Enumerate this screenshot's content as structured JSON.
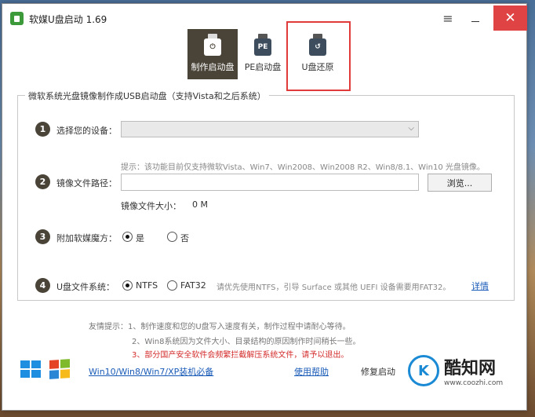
{
  "window": {
    "title": "软媒U盘启动 1.69",
    "menu_icon": "hamburger-icon",
    "min_icon": "minimize-icon",
    "close_glyph": "✕"
  },
  "tabs": [
    {
      "label": "制作启动盘",
      "icon": "power",
      "active": true
    },
    {
      "label": "PE启动盘",
      "icon": "PE",
      "active": false
    },
    {
      "label": "U盘还原",
      "icon": "restore",
      "active": false
    }
  ],
  "group": {
    "title": "微软系统光盘镜像制作成USB启动盘（支持Vista和之后系统）"
  },
  "steps": {
    "s1": {
      "num": "1",
      "label": "选择您的设备："
    },
    "s2": {
      "num": "2",
      "label": "镜像文件路径：",
      "hint": "提示：该功能目前仅支持微软Vista、Win7、Win2008、Win2008 R2、Win8/8.1、Win10 光盘镜像。",
      "browse": "浏览...",
      "size_label": "镜像文件大小：",
      "size_value": "0 M"
    },
    "s3": {
      "num": "3",
      "label": "附加软媒魔方：",
      "opt_yes": "是",
      "opt_no": "否"
    },
    "s4": {
      "num": "4",
      "label": "U盘文件系统：",
      "opt_ntfs": "NTFS",
      "opt_fat32": "FAT32",
      "hint": "请优先使用NTFS，引导 Surface 或其他 UEFI 设备需要用FAT32。",
      "details": "详情"
    }
  },
  "tips": {
    "t1": "友情提示：1、制作速度和您的U盘写入速度有关，制作过程中请耐心等待。",
    "t2": "2、Win8系统因为文件大小、目录结构的原因制作时间稍长一些。",
    "t3": "3、部分国产安全软件会频繁拦截解压系统文件，请予以退出。"
  },
  "footer": {
    "link_systems": "Win10/Win8/Win7/XP装机必备",
    "help": "使用帮助",
    "repair": "修复启动"
  },
  "watermark": {
    "glyph": "K",
    "brand": "酷知网",
    "url": "www.coozhi.com"
  },
  "colors": {
    "accent_dark": "#4a4438",
    "close_red": "#e04343",
    "link_blue": "#1a5bb8",
    "warning_red": "#d42c2c",
    "highlight_red": "#e03a3a"
  }
}
